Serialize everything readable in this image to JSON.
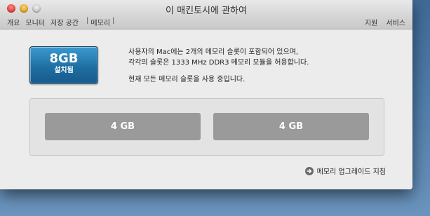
{
  "window": {
    "title": "이 매킨토시에 관하여"
  },
  "toolbar": {
    "tabs": [
      "개요",
      "모니터",
      "저장 공간",
      "메모리"
    ],
    "right_links": [
      "지원",
      "서비스"
    ]
  },
  "memory": {
    "size": "8GB",
    "status": "설치됨",
    "description_line1": "사용자의 Mac에는 2개의 메모리 슬롯이 포함되어 있으며,",
    "description_line2": "각각의 슬롯은 1333 MHz DDR3 메모리 모듈을 허용합니다.",
    "usage_status": "현재 모든 메모리 슬롯을 사용 중입니다.",
    "slots": [
      "4 GB",
      "4 GB"
    ],
    "upgrade_link": "메모리 업그레이드 지침"
  }
}
